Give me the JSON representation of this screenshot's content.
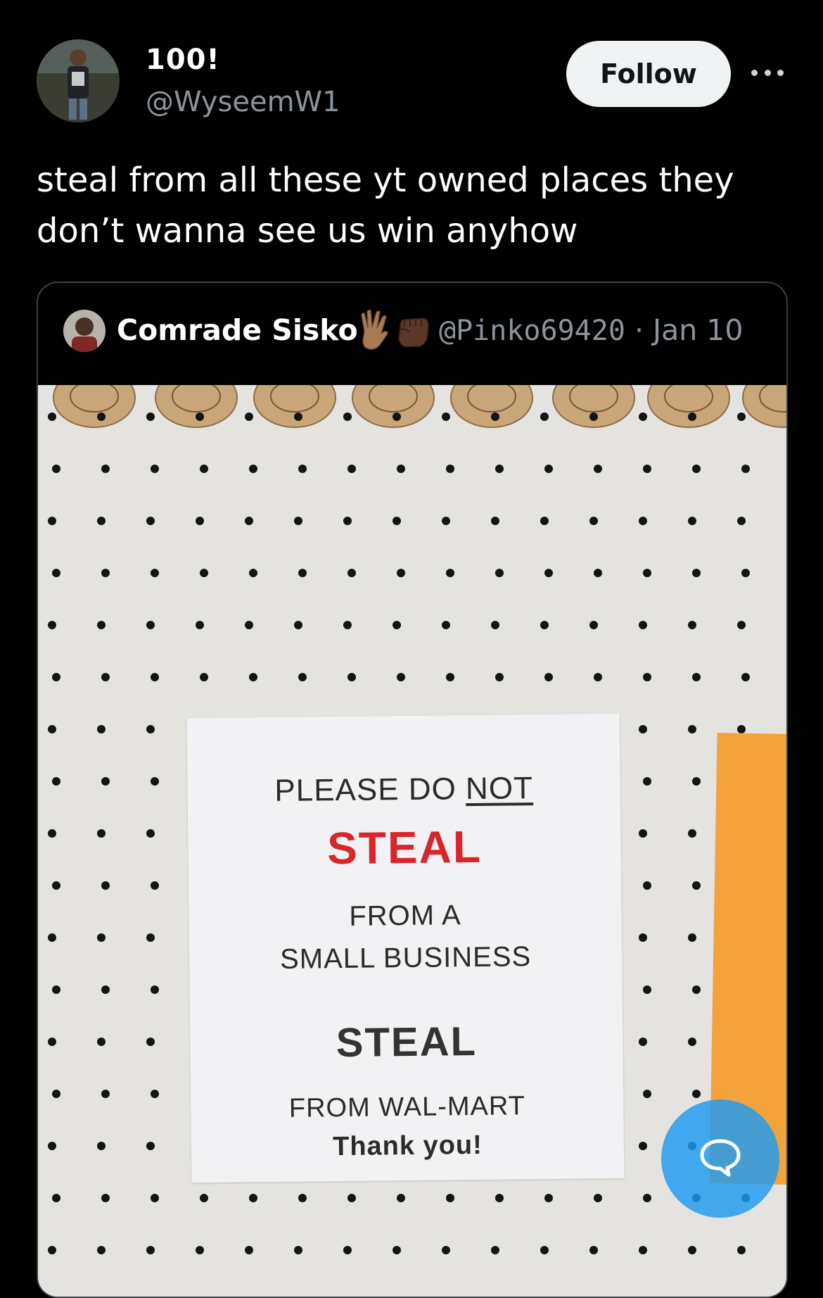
{
  "author": {
    "name": "100!",
    "handle": "@WyseemW1"
  },
  "follow_label": "Follow",
  "post": {
    "text_line1": "steal from all these yt owned places they",
    "text_line2": "don’t wanna see us win anyhow"
  },
  "quoted": {
    "name": "Comrade Sisko",
    "handle": "@Pinko69420",
    "separator": " · ",
    "date": "Jan 10",
    "emojis": [
      "vulcan-salute-icon",
      "raised-fist-icon"
    ]
  },
  "sign": {
    "line1_prefix": "PLEASE DO ",
    "line1_underlined": "NOT",
    "line2": "STEAL",
    "line3": "FROM A",
    "line4": "SMALL BUSINESS",
    "line5": "STEAL",
    "line6": "FROM WAL-MART",
    "line7": "Thank you!"
  },
  "colors": {
    "background": "#000000",
    "follow_button_bg": "#eff3f4",
    "fab": "#1d9bf0",
    "sign_red": "#d8262b",
    "orange_sheet": "#f4a23c"
  }
}
